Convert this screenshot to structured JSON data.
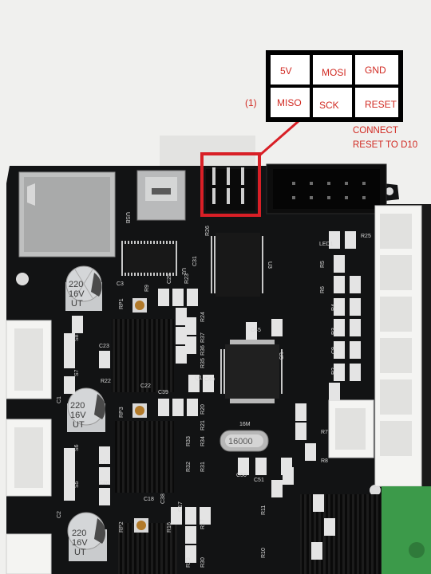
{
  "pinout": {
    "row1": [
      "5V",
      "MOSI",
      "GND"
    ],
    "row2": [
      "MISO",
      "SCK",
      "RESET"
    ],
    "side_label": "(1)",
    "note_line1": "CONNECT",
    "note_line2": "RESET TO D10"
  },
  "board": {
    "cap_top_lines": [
      "220",
      "16V",
      "UT"
    ],
    "cap_mid_lines": [
      "220",
      "16V",
      "UT"
    ],
    "cap_bot_lines": [
      "220",
      "16V",
      "UT"
    ],
    "crystal_label": "16000",
    "usb_label": "USB",
    "chip_u2": "U2",
    "chip_u3": "U3",
    "chip_u5": "U5",
    "crystal_ref": "16M",
    "led_label": "LED1",
    "comp_labels": [
      "R25",
      "R26",
      "R23",
      "R24",
      "R37",
      "R36",
      "R35",
      "R22",
      "R20",
      "R21",
      "R33",
      "R32",
      "R31",
      "R34",
      "R16",
      "R17",
      "R29",
      "R30",
      "R11",
      "R10",
      "R7",
      "R8",
      "R9",
      "C25",
      "C31",
      "C45",
      "C40",
      "C39",
      "C3",
      "C2",
      "C1",
      "C22",
      "C23",
      "C19",
      "C20",
      "C50",
      "C51",
      "C38",
      "C18",
      "C17",
      "RP1",
      "RP2",
      "RP3",
      "S5",
      "S6",
      "S7",
      "S8",
      "Q1",
      "R5",
      "R4",
      "R6",
      "R3",
      "R2",
      "C9"
    ],
    "colors": {
      "pcb": "#121314",
      "silkscreen": "#e8e8e8",
      "highlight": "#d81f26",
      "connector": "#f2f2f0",
      "terminal": "#3c9a4a"
    }
  }
}
